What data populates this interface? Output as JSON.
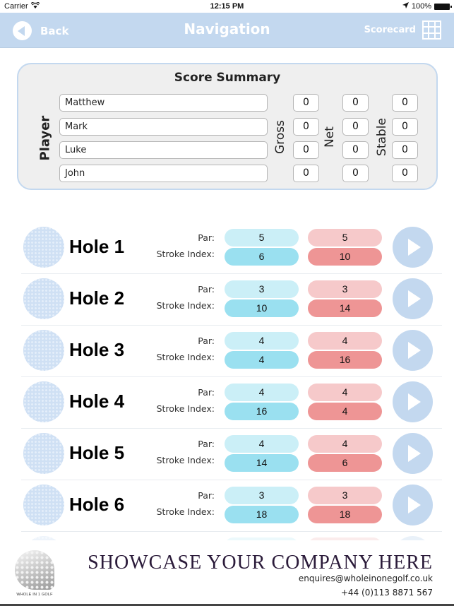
{
  "status_bar": {
    "carrier": "Carrier",
    "time": "12:15 PM",
    "battery": "100%"
  },
  "nav": {
    "back_label": "Back",
    "title": "Navigation",
    "scorecard_label": "Scorecard"
  },
  "summary": {
    "title": "Score Summary",
    "player_label": "Player",
    "gross_label": "Gross",
    "net_label": "Net",
    "stable_label": "Stable",
    "players": [
      {
        "name": "Matthew",
        "gross": "0",
        "net": "0",
        "stable": "0"
      },
      {
        "name": "Mark",
        "gross": "0",
        "net": "0",
        "stable": "0"
      },
      {
        "name": "Luke",
        "gross": "0",
        "net": "0",
        "stable": "0"
      },
      {
        "name": "John",
        "gross": "0",
        "net": "0",
        "stable": "0"
      }
    ]
  },
  "holes": {
    "par_label": "Par:",
    "si_label": "Stroke Index:",
    "colors": {
      "blue_light": "#cbeff7",
      "blue_dark": "#9ae0f0",
      "red_light": "#f6c9ca",
      "red_dark": "#ee9595",
      "accent": "#c3d8ef"
    },
    "items": [
      {
        "name": "Hole 1",
        "par_a": "5",
        "si_a": "6",
        "par_b": "5",
        "si_b": "10"
      },
      {
        "name": "Hole 2",
        "par_a": "3",
        "si_a": "10",
        "par_b": "3",
        "si_b": "14"
      },
      {
        "name": "Hole 3",
        "par_a": "4",
        "si_a": "4",
        "par_b": "4",
        "si_b": "16"
      },
      {
        "name": "Hole 4",
        "par_a": "4",
        "si_a": "16",
        "par_b": "4",
        "si_b": "4"
      },
      {
        "name": "Hole 5",
        "par_a": "4",
        "si_a": "14",
        "par_b": "4",
        "si_b": "6"
      },
      {
        "name": "Hole 6",
        "par_a": "3",
        "si_a": "18",
        "par_b": "3",
        "si_b": "18"
      }
    ]
  },
  "footer": {
    "logo_text": "WHOLE IN 1 GOLF",
    "headline": "SHOWCASE YOUR COMPANY HERE",
    "email": "enquires@wholeinonegolf.co.uk",
    "phone": "+44 (0)113 8871 567"
  }
}
